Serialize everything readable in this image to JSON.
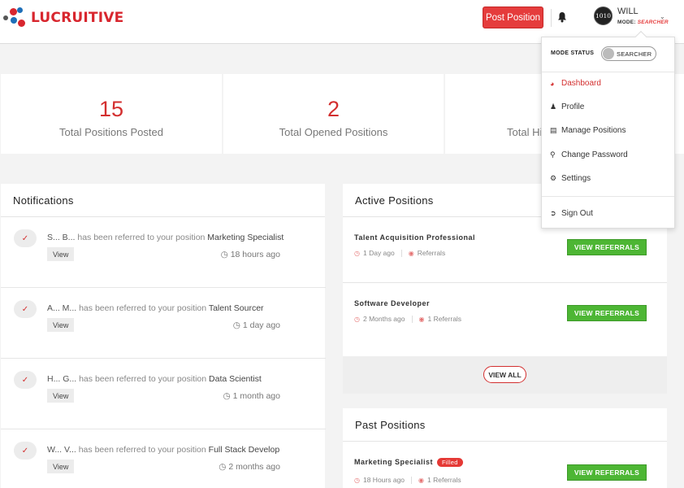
{
  "header": {
    "logo_text": "LUCRUITIVE",
    "post_button": "Post Position",
    "avatar_text": "1010",
    "user_name": "WILL",
    "mode_label": "MODE:",
    "mode_value": "SEARCHER"
  },
  "stats": [
    {
      "value": "15",
      "label": "Total Positions Posted"
    },
    {
      "value": "2",
      "label": "Total Opened Positions"
    },
    {
      "value": "",
      "label": "Total Hi"
    }
  ],
  "notifications": {
    "title": "Notifications",
    "view_label": "View",
    "items": [
      {
        "who": "S... B...",
        "text": "has been referred to your position",
        "position": "Marketing Specialist",
        "time": "18 hours ago"
      },
      {
        "who": "A... M...",
        "text": "has been referred to your position",
        "position": "Talent Sourcer",
        "time": "1 day ago"
      },
      {
        "who": "H... G...",
        "text": "has been referred to your position",
        "position": "Data Scientist",
        "time": "1 month ago"
      },
      {
        "who": "W... V...",
        "text": "has been referred to your position",
        "position": "Full Stack Develop",
        "time": "2 months ago"
      }
    ]
  },
  "active_positions": {
    "title": "Active Positions",
    "button_label": "VIEW REFERRALS",
    "view_all": "VIEW ALL",
    "items": [
      {
        "title": "Talent Acquisition Professional",
        "age": "1 Day ago",
        "referrals": "Referrals"
      },
      {
        "title": "Software Developer",
        "age": "2 Months ago",
        "referrals": "1 Referrals"
      }
    ]
  },
  "past_positions": {
    "title": "Past Positions",
    "button_label": "VIEW REFERRALS",
    "items": [
      {
        "title": "Marketing Specialist",
        "badge": "Filled",
        "age": "18 Hours ago",
        "referrals": "1 Referrals"
      }
    ]
  },
  "dropdown": {
    "mode_status_label": "MODE STATUS",
    "toggle_label": "SEARCHER",
    "items": [
      {
        "label": "Dashboard",
        "icon": "dashboard-icon"
      },
      {
        "label": "Profile",
        "icon": "user-icon"
      },
      {
        "label": "Manage Positions",
        "icon": "briefcase-icon"
      },
      {
        "label": "Change Password",
        "icon": "key-icon"
      },
      {
        "label": "Settings",
        "icon": "gear-icon"
      }
    ],
    "sign_out": "Sign Out",
    "colors": {
      "accent": "#d32f2f",
      "success": "#4db634"
    }
  }
}
